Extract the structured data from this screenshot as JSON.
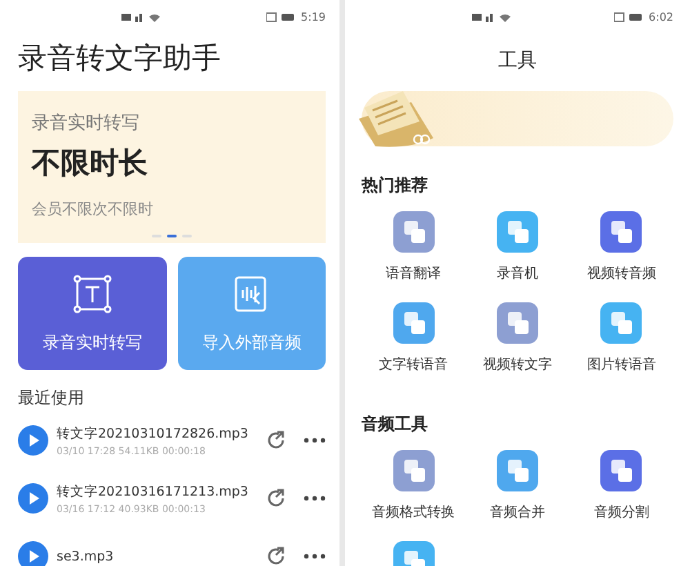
{
  "recorder_screen": {
    "status_bar": {
      "time": "5:19"
    },
    "title": "录音转文字助手",
    "banner": {
      "subtitle": "录音实时转写",
      "headline": "不限时长",
      "note": "会员不限次不限时",
      "pages": [
        {
          "selected": false
        },
        {
          "selected": true
        },
        {
          "selected": false
        }
      ]
    },
    "actions": [
      {
        "label": "录音实时转写",
        "kind": "record",
        "color": "#5a5fd6"
      },
      {
        "label": "导入外部音频",
        "kind": "import",
        "color": "#5aa9ef"
      }
    ],
    "recent": {
      "heading": "最近使用",
      "files": [
        {
          "name": "转文字20210310172826.mp3",
          "meta": "03/10 17:28 54.11KB 00:00:18"
        },
        {
          "name": "转文字20210316171213.mp3",
          "meta": "03/16 17:12 40.93KB 00:00:13"
        },
        {
          "name": "se3.mp3"
        }
      ]
    }
  },
  "tools_screen": {
    "status_bar": {
      "time": "6:02"
    },
    "title": "工具",
    "sections": [
      {
        "heading": "热门推荐",
        "tools": [
          {
            "label": "语音翻译",
            "color": "#8d9fd2"
          },
          {
            "label": "录音机",
            "color": "#46b3f2"
          },
          {
            "label": "视频转音频",
            "color": "#5b6fe6"
          },
          {
            "label": "文字转语音",
            "color": "#4fa8ee"
          },
          {
            "label": "视频转文字",
            "color": "#8d9fd2"
          },
          {
            "label": "图片转语音",
            "color": "#46b3f2"
          }
        ]
      },
      {
        "heading": "音频工具",
        "tools": [
          {
            "label": "音频格式转换",
            "color": "#8d9fd2"
          },
          {
            "label": "音频合并",
            "color": "#4fa8ee"
          },
          {
            "label": "音频分割",
            "color": "#5b6fe6"
          },
          {
            "color": "#46b3f2"
          }
        ]
      }
    ]
  }
}
